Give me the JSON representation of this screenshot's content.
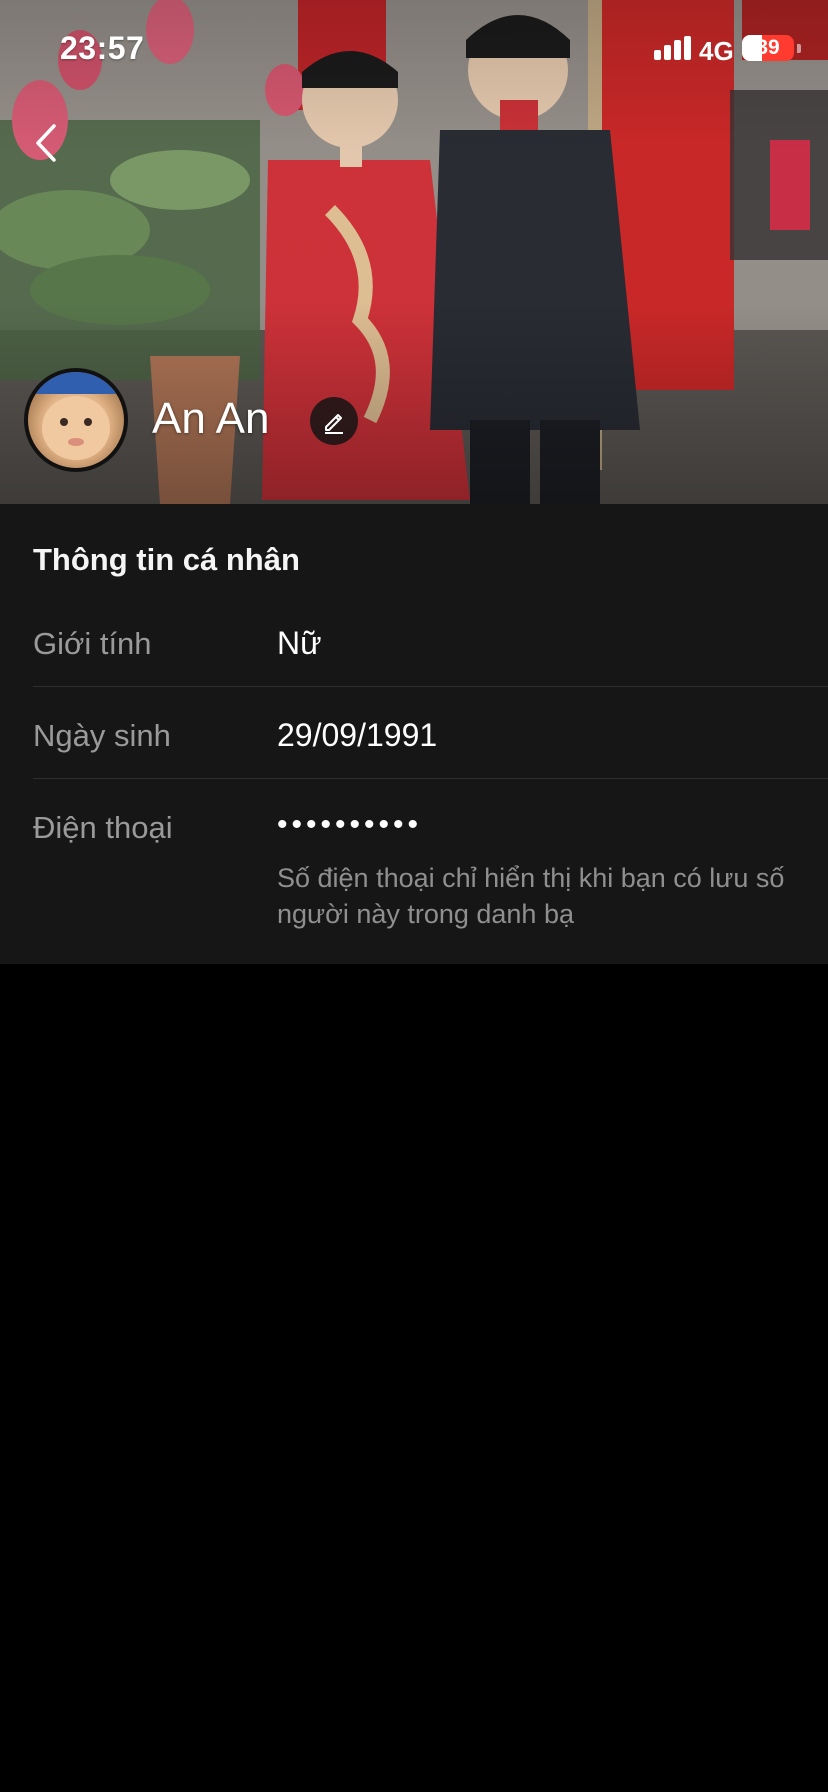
{
  "status_bar": {
    "time": "23:57",
    "network": "4G",
    "battery": "39",
    "battery_fraction": 0.39
  },
  "header": {
    "back_icon": "chevron-left-icon",
    "name": "An An",
    "edit_icon": "pencil-icon"
  },
  "info": {
    "title": "Thông tin cá nhân",
    "rows": [
      {
        "label": "Giới tính",
        "value": "Nữ"
      },
      {
        "label": "Ngày sinh",
        "value": "29/09/1991"
      },
      {
        "label": "Điện thoại",
        "value": "••••••••••",
        "note": "Số điện thoại chỉ hiển thị khi bạn có lưu số người này trong danh bạ"
      }
    ]
  },
  "colors": {
    "panel_bg": "#161616",
    "page_bg": "#000000",
    "label": "#9a9a9a",
    "battery_low": "#ff3b30"
  }
}
